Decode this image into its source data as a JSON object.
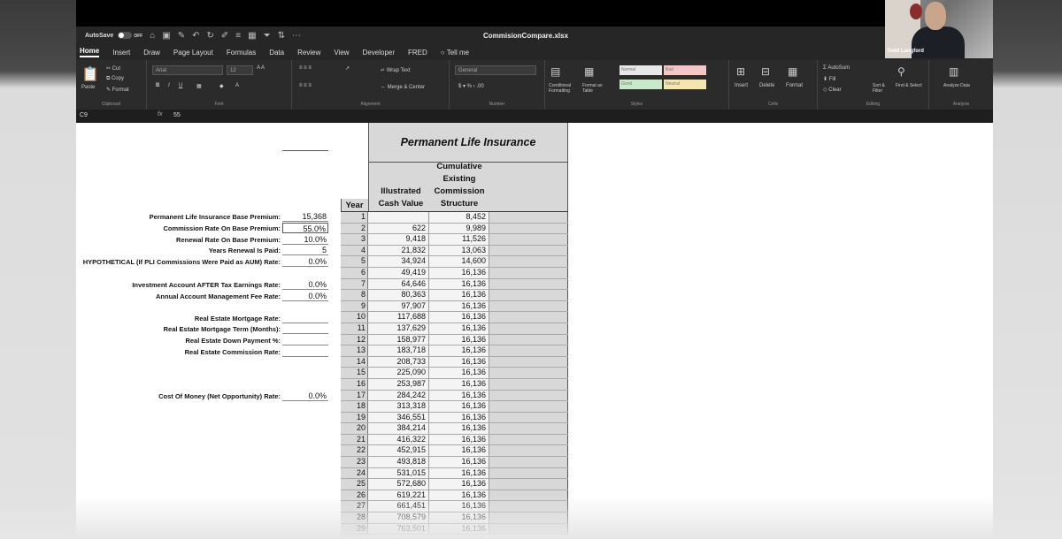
{
  "app": {
    "autosave_label": "AutoSave",
    "autosave_state": "OFF",
    "filename": "CommisionCompare.xlsx"
  },
  "tabs": [
    "Home",
    "Insert",
    "Draw",
    "Page Layout",
    "Formulas",
    "Data",
    "Review",
    "View",
    "Developer",
    "FRED",
    "Tell me"
  ],
  "ribbon": {
    "clipboard": {
      "paste": "Paste",
      "cut": "Cut",
      "copy": "Copy",
      "format": "Format",
      "label": "Clipboard"
    },
    "font": {
      "name": "Arial",
      "size": "12",
      "label": "Font"
    },
    "alignment": {
      "wrap": "Wrap Text",
      "merge": "Merge & Center",
      "label": "Alignment"
    },
    "number": {
      "format": "General",
      "label": "Number"
    },
    "styles": {
      "cond": "Conditional Formatting",
      "table": "Format as Table",
      "normal": "Normal",
      "bad": "Bad",
      "good": "Good",
      "neutral": "Neutral",
      "label": "Styles"
    },
    "cells": {
      "insert": "Insert",
      "delete": "Delete",
      "format": "Format",
      "label": "Cells"
    },
    "editing": {
      "autosum": "AutoSum",
      "fill": "Fill",
      "clear": "Clear",
      "sort": "Sort & Filter",
      "find": "Find & Select",
      "label": "Editing"
    },
    "analysis": {
      "analyze": "Analyze Data",
      "label": "Analysis"
    }
  },
  "formula_bar": {
    "cell": "C9",
    "value": "55"
  },
  "webcam": {
    "name": "Todd Langford"
  },
  "inputs": [
    {
      "label": "Permanent Life Insurance Base Premium:",
      "value": "15,368"
    },
    {
      "label": "Commission Rate On Base Premium:",
      "value": "55.0%"
    },
    {
      "label": "Renewal Rate On Base Premium:",
      "value": "10.0%"
    },
    {
      "label": "Years Renewal Is Paid:",
      "value": "5"
    },
    {
      "label": "HYPOTHETICAL (If PLI Commissions Were Paid as AUM) Rate:",
      "value": "0.0%"
    },
    {
      "label": "Investment Account AFTER Tax Earnings Rate:",
      "value": "0.0%"
    },
    {
      "label": "Annual Account Management Fee Rate:",
      "value": "0.0%"
    },
    {
      "label": "Real Estate Mortgage Rate:",
      "value": ""
    },
    {
      "label": "Real Estate Mortgage Term (Months):",
      "value": ""
    },
    {
      "label": "Real Estate Down Payment %:",
      "value": ""
    },
    {
      "label": "Real Estate Commission Rate:",
      "value": ""
    },
    {
      "label": "Cost Of Money (Net Opportunity) Rate:",
      "value": "0.0%"
    }
  ],
  "table": {
    "title": "Permanent Life Insurance",
    "col_year": "Year",
    "col_cash_1": "Illustrated",
    "col_cash_2": "Cash Value",
    "col_comm_1": "Cumulative",
    "col_comm_2": "Existing",
    "col_comm_3": "Commission",
    "col_comm_4": "Structure",
    "rows": [
      [
        "1",
        "",
        "8,452"
      ],
      [
        "2",
        "622",
        "9,989"
      ],
      [
        "3",
        "9,418",
        "11,526"
      ],
      [
        "4",
        "21,832",
        "13,063"
      ],
      [
        "5",
        "34,924",
        "14,600"
      ],
      [
        "6",
        "49,419",
        "16,136"
      ],
      [
        "7",
        "64,646",
        "16,136"
      ],
      [
        "8",
        "80,363",
        "16,136"
      ],
      [
        "9",
        "97,907",
        "16,136"
      ],
      [
        "10",
        "117,688",
        "16,136"
      ],
      [
        "11",
        "137,629",
        "16,136"
      ],
      [
        "12",
        "158,977",
        "16,136"
      ],
      [
        "13",
        "183,718",
        "16,136"
      ],
      [
        "14",
        "208,733",
        "16,136"
      ],
      [
        "15",
        "225,090",
        "16,136"
      ],
      [
        "16",
        "253,987",
        "16,136"
      ],
      [
        "17",
        "284,242",
        "16,136"
      ],
      [
        "18",
        "313,318",
        "16,136"
      ],
      [
        "19",
        "346,551",
        "16,136"
      ],
      [
        "20",
        "384,214",
        "16,136"
      ],
      [
        "21",
        "416,322",
        "16,136"
      ],
      [
        "22",
        "452,915",
        "16,136"
      ],
      [
        "23",
        "493,818",
        "16,136"
      ],
      [
        "24",
        "531,015",
        "16,136"
      ],
      [
        "25",
        "572,680",
        "16,136"
      ],
      [
        "26",
        "619,221",
        "16,136"
      ],
      [
        "27",
        "661,451",
        "16,136"
      ],
      [
        "28",
        "708,579",
        "16,136"
      ],
      [
        "29",
        "763,501",
        "16,136"
      ]
    ]
  }
}
